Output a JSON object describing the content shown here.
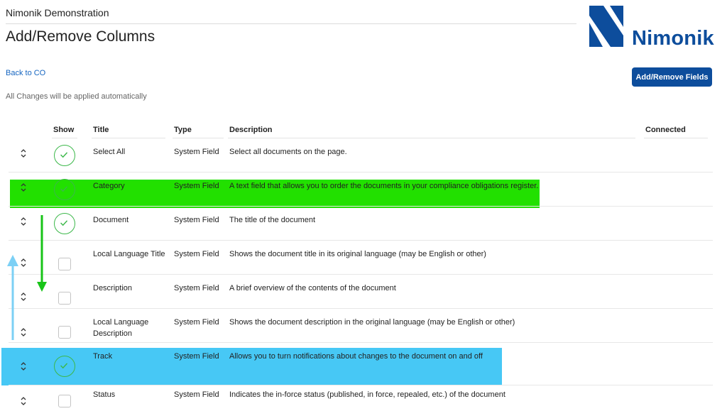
{
  "header": {
    "org": "Nimonik Demonstration",
    "title": "Add/Remove Columns",
    "logo_text": "Nimonik",
    "back_link": "Back to CO",
    "autosave_note": "All Changes will be applied automatically",
    "add_remove_fields": "Add/Remove Fields"
  },
  "colors": {
    "brand": "#0d4d9c",
    "highlight_green": "#22e000",
    "highlight_blue": "#47c8f5",
    "arrow_green": "#18c418",
    "arrow_blue": "#7cd0f5",
    "check_green": "#3cb84a"
  },
  "table": {
    "columns": [
      "Show",
      "Title",
      "Type",
      "Description",
      "Connected"
    ],
    "rows": [
      {
        "show": true,
        "title": "Select All",
        "type": "System Field",
        "description": "Select all documents on the page."
      },
      {
        "show": true,
        "title": "Category",
        "type": "System Field",
        "description": "A text field that allows you to order the documents in your compliance obligations register."
      },
      {
        "show": true,
        "title": "Document",
        "type": "System Field",
        "description": "The title of the document"
      },
      {
        "show": false,
        "title": "Local Language Title",
        "type": "System Field",
        "description": "Shows the document title in its original language (may be English or other)"
      },
      {
        "show": false,
        "title": "Description",
        "type": "System Field",
        "description": "A brief overview of the contents of the document"
      },
      {
        "show": false,
        "title": "Local Language Description",
        "type": "System Field",
        "description": "Shows the document description in the original language (may be English or other)"
      },
      {
        "show": true,
        "title": "Track",
        "type": "System Field",
        "description": "Allows you to turn notifications about changes to the document on and off"
      },
      {
        "show": false,
        "title": "Status",
        "type": "System Field",
        "description": "Indicates the in-force status (published, in force, repealed, etc.) of the document"
      }
    ]
  }
}
